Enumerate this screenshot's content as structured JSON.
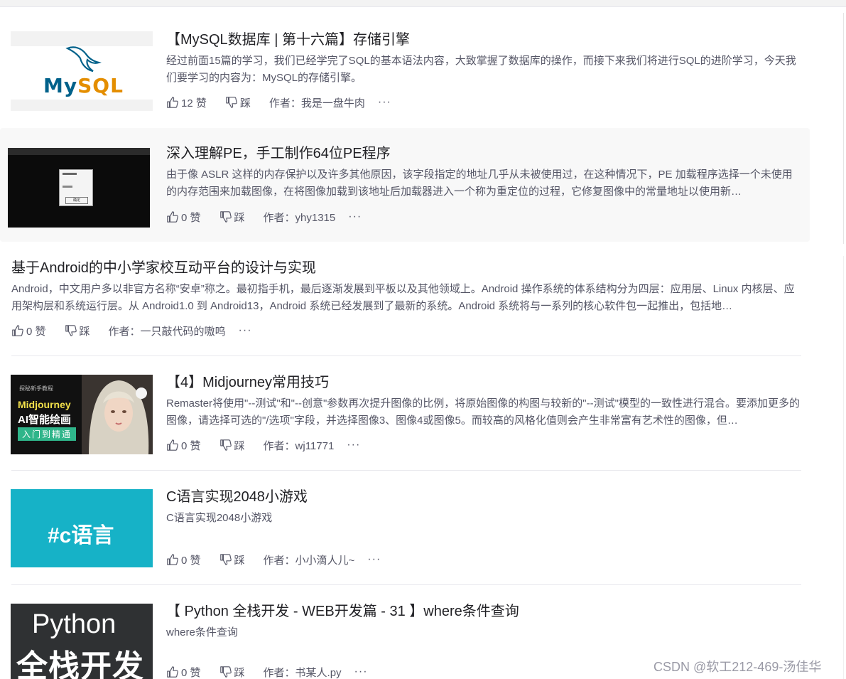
{
  "watermark": "CSDN @软工212-469-汤佳华",
  "articles": [
    {
      "title": "【MySQL数据库 | 第十六篇】存储引擎",
      "desc": "经过前面15篇的学习，我们已经学完了SQL的基本语法内容，大致掌握了数据库的操作，而接下来我们将进行SQL的进阶学习，今天我们要学习的内容为：MySQL的存储引擎。",
      "likes": "12 赞",
      "tread": "踩",
      "author": "作者：我是一盘牛肉",
      "more": "···",
      "thumb": {
        "word_a": "My",
        "word_b": "SQL"
      }
    },
    {
      "title": "深入理解PE，手工制作64位PE程序",
      "desc": "由于像 ASLR 这样的内存保护以及许多其他原因，该字段指定的地址几乎从未被使用过，在这种情况下，PE 加载程序选择一个未使用的内存范围来加载图像，在将图像加载到该地址后加载器进入一个称为重定位的过程，它修复图像中的常量地址以使用新…",
      "likes": "0 赞",
      "tread": "踩",
      "author": "作者：yhy1315",
      "more": "···",
      "thumb": {
        "dialog_btn": "确定"
      }
    },
    {
      "title": "基于Android的中小学家校互动平台的设计与实现",
      "desc": "Android，中文用户多以非官方名称“安卓”称之。最初指手机，最后逐渐发展到平板以及其他领域上。Android 操作系统的体系结构分为四层：应用层、Linux 内核层、应用架构层和系统运行层。从 Android1.0 到 Android13，Android 系统已经发展到了最新的系统。Android 系统将与一系列的核心软件包一起推出，包括地…",
      "likes": "0 赞",
      "tread": "踩",
      "author": "作者：一只敲代码的嗷呜",
      "more": "···"
    },
    {
      "title": "【4】Midjourney常用技巧",
      "desc": "Remaster将使用\"--测试\"和\"--创意\"参数再次提升图像的比例，将原始图像的构图与较新的\"--测试\"模型的一致性进行混合。要添加更多的图像，请选择可选的\"/选项\"字段，并选择图像3、图像4或图像5。而较高的风格化值则会产生非常富有艺术性的图像，但…",
      "likes": "0 赞",
      "tread": "踩",
      "author": "作者：wj11771",
      "more": "···",
      "thumb": {
        "tag": "探秘新手教程",
        "line1": "Midjourney",
        "line2": "AI智能绘画",
        "line3": "入门到精通"
      }
    },
    {
      "title": "C语言实现2048小游戏",
      "desc": "C语言实现2048小游戏",
      "likes": "0 赞",
      "tread": "踩",
      "author": "作者：小小滴人儿~",
      "more": "···",
      "thumb": {
        "text": "#c语言"
      }
    },
    {
      "title": "【 Python 全栈开发 - WEB开发篇 - 31 】where条件查询",
      "desc": "where条件查询",
      "likes": "0 赞",
      "tread": "踩",
      "author": "作者：书某人.py",
      "more": "···",
      "thumb": {
        "line1": "Python",
        "line2": "全栈开发"
      }
    }
  ]
}
